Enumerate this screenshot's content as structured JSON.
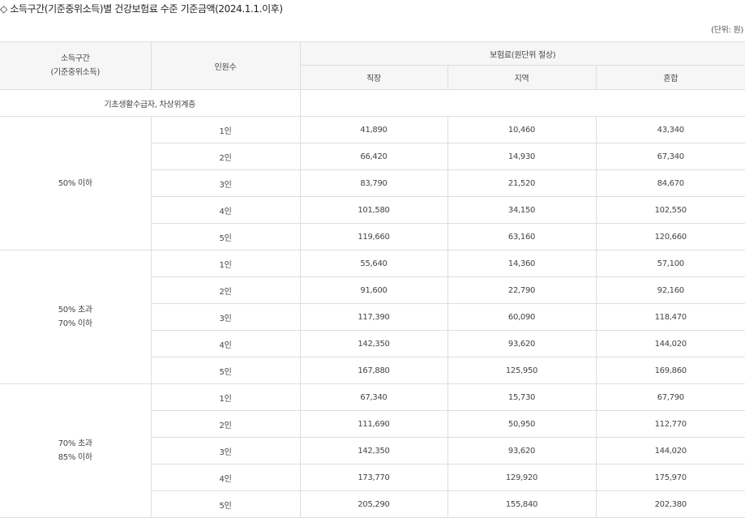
{
  "title": "◇ 소득구간(기준중위소득)별 건강보험료 수준 기준금액(2024.1.1.이후)",
  "unit": "(단위: 원)",
  "table": {
    "header": {
      "income_band_line1": "소득구간",
      "income_band_line2": "(기준중위소득)",
      "household_size": "인원수",
      "premium": "보험료(원단위 절상)",
      "employee": "직장",
      "regional": "지역",
      "mixed": "혼합"
    },
    "basic_row": {
      "label": "기초생활수급자, 차상위계층"
    },
    "groups": [
      {
        "band_line1": "50% 이하",
        "band_line2": "",
        "rows": [
          {
            "size": "1인",
            "employee": "41,890",
            "regional": "10,460",
            "mixed": "43,340"
          },
          {
            "size": "2인",
            "employee": "66,420",
            "regional": "14,930",
            "mixed": "67,340"
          },
          {
            "size": "3인",
            "employee": "83,790",
            "regional": "21,520",
            "mixed": "84,670"
          },
          {
            "size": "4인",
            "employee": "101,580",
            "regional": "34,150",
            "mixed": "102,550"
          },
          {
            "size": "5인",
            "employee": "119,660",
            "regional": "63,160",
            "mixed": "120,660"
          }
        ]
      },
      {
        "band_line1": "50% 초과",
        "band_line2": "70% 이하",
        "rows": [
          {
            "size": "1인",
            "employee": "55,640",
            "regional": "14,360",
            "mixed": "57,100"
          },
          {
            "size": "2인",
            "employee": "91,600",
            "regional": "22,790",
            "mixed": "92,160"
          },
          {
            "size": "3인",
            "employee": "117,390",
            "regional": "60,090",
            "mixed": "118,470"
          },
          {
            "size": "4인",
            "employee": "142,350",
            "regional": "93,620",
            "mixed": "144,020"
          },
          {
            "size": "5인",
            "employee": "167,880",
            "regional": "125,950",
            "mixed": "169,860"
          }
        ]
      },
      {
        "band_line1": "70% 초과",
        "band_line2": "85% 이하",
        "rows": [
          {
            "size": "1인",
            "employee": "67,340",
            "regional": "15,730",
            "mixed": "67,790"
          },
          {
            "size": "2인",
            "employee": "111,690",
            "regional": "50,950",
            "mixed": "112,770"
          },
          {
            "size": "3인",
            "employee": "142,350",
            "regional": "93,620",
            "mixed": "144,020"
          },
          {
            "size": "4인",
            "employee": "173,770",
            "regional": "129,920",
            "mixed": "175,970"
          },
          {
            "size": "5인",
            "employee": "205,290",
            "regional": "155,840",
            "mixed": "202,380"
          }
        ]
      }
    ]
  }
}
